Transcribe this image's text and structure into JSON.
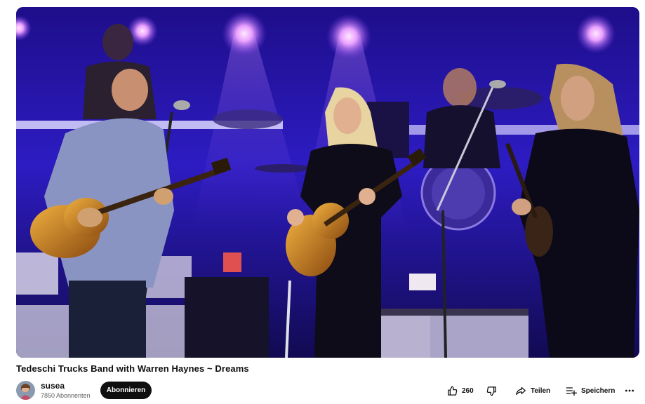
{
  "video": {
    "title": "Tedeschi Trucks Band with Warren Haynes ~ Dreams"
  },
  "channel": {
    "name": "susea",
    "subscribers": "7850 Abonnenten",
    "subscribe_label": "Abonnieren"
  },
  "actions": {
    "like_count": "260",
    "share_label": "Teilen",
    "save_label": "Speichern"
  },
  "icons": {
    "like": "thumbs-up-icon",
    "dislike": "thumbs-down-icon",
    "share": "share-arrow-icon",
    "save": "playlist-add-icon",
    "more": "more-dots-icon"
  },
  "colors": {
    "stage_blue": "#2a18b8",
    "stage_purple": "#6b2ad8",
    "button_black": "#0f0f0f",
    "secondary_text": "#606060"
  }
}
